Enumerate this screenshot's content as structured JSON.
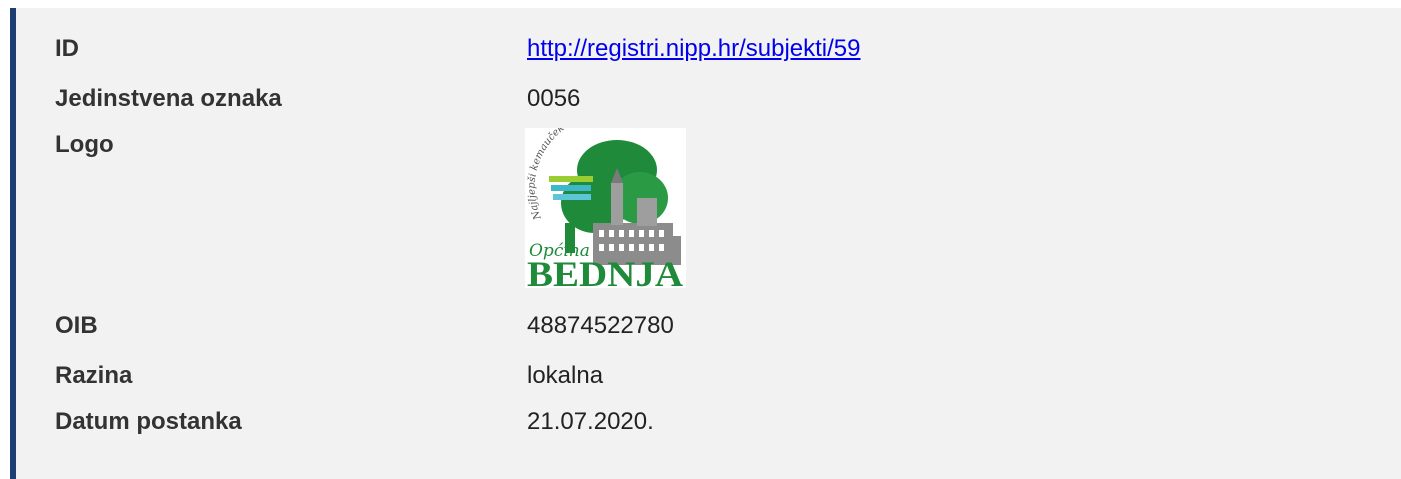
{
  "rows": {
    "id": {
      "label": "ID",
      "value": "http://registri.nipp.hr/subjekti/59"
    },
    "code": {
      "label": "Jedinstvena oznaka",
      "value": "0056"
    },
    "logo": {
      "label": "Logo",
      "script_text": "Najljepši kemauček svieto Bednjo",
      "logo_line1": "Općina",
      "logo_line2": "BEDNJA"
    },
    "oib": {
      "label": "OIB",
      "value": "48874522780"
    },
    "level": {
      "label": "Razina",
      "value": "lokalna"
    },
    "date": {
      "label": "Datum postanka",
      "value": "21.07.2020."
    }
  },
  "colors": {
    "accent_border": "#1f3f73",
    "panel_bg": "#f2f2f2",
    "link": "#0000ee",
    "logo_green": "#1e8a3a",
    "logo_gray": "#8c8c8c"
  }
}
